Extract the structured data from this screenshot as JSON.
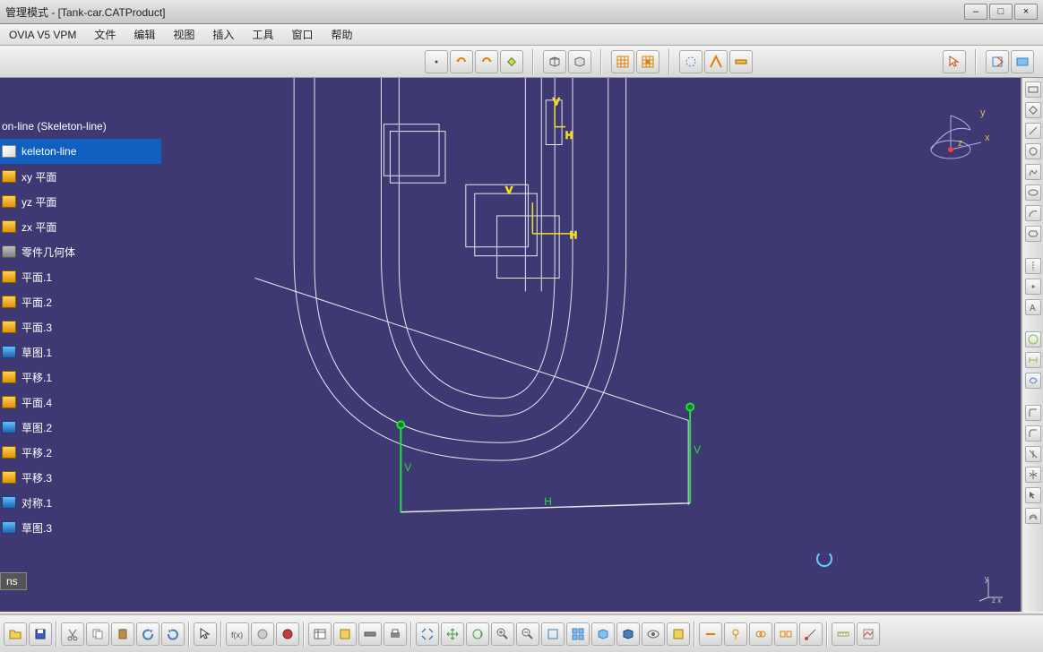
{
  "app": {
    "title": "管理模式 - [Tank-car.CATProduct]",
    "minimize": "–",
    "maximize": "□",
    "close": "×"
  },
  "menu": {
    "vpm": "OVIA V5 VPM",
    "file": "文件",
    "edit": "编辑",
    "view": "视图",
    "insert": "插入",
    "tools": "工具",
    "window": "窗口",
    "help": "帮助"
  },
  "tree": {
    "root": "on-line (Skeleton-line)",
    "selected": "keleton-line",
    "items": [
      {
        "icon": "plane",
        "label": "xy 平面"
      },
      {
        "icon": "plane",
        "label": "yz 平面"
      },
      {
        "icon": "plane",
        "label": "zx 平面"
      },
      {
        "icon": "part",
        "label": "零件几何体"
      },
      {
        "icon": "plane",
        "label": "平面.1"
      },
      {
        "icon": "plane",
        "label": "平面.2"
      },
      {
        "icon": "plane",
        "label": "平面.3"
      },
      {
        "icon": "sketch",
        "label": "草图.1"
      },
      {
        "icon": "plane",
        "label": "平移.1"
      },
      {
        "icon": "plane",
        "label": "平面.4"
      },
      {
        "icon": "sketch",
        "label": "草图.2"
      },
      {
        "icon": "plane",
        "label": "平移.2"
      },
      {
        "icon": "plane",
        "label": "平移.3"
      },
      {
        "icon": "sketch",
        "label": "对称.1"
      },
      {
        "icon": "sketch",
        "label": "草图.3"
      }
    ],
    "bottom": "ns"
  },
  "compass": {
    "x": "x",
    "y": "y",
    "z": "z"
  },
  "constraints": {
    "h": "H",
    "v1": "V",
    "v2": "V"
  },
  "mini_axis": {
    "y": "y",
    "zx": "z x"
  }
}
